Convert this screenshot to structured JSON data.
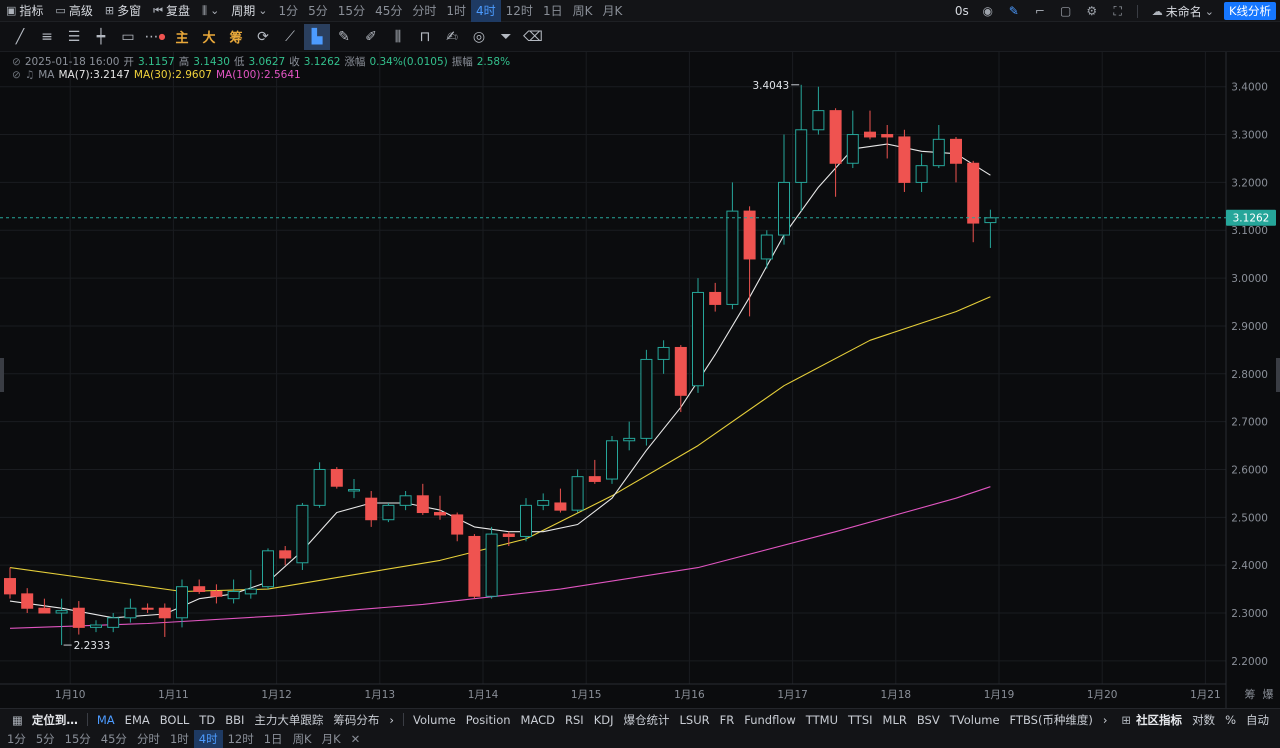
{
  "topbar": {
    "tools": [
      {
        "icon": "indicator-icon",
        "label": "指标"
      },
      {
        "icon": "advanced-icon",
        "label": "高级"
      },
      {
        "icon": "multi-window-icon",
        "label": "多窗"
      },
      {
        "icon": "replay-icon",
        "label": "复盘"
      }
    ],
    "chart_type_icon": "candle-type-icon",
    "period_label": "周期",
    "periods": [
      "1分",
      "5分",
      "15分",
      "45分",
      "分时",
      "1时",
      "4时",
      "12时",
      "1日",
      "周K",
      "月K"
    ],
    "active_period": "4时",
    "countdown": "0s",
    "template_name": "未命名",
    "analysis_button": "K线分析"
  },
  "drawbar": {
    "tools": [
      {
        "name": "trend-line-icon",
        "glyph": "╱"
      },
      {
        "name": "parallel-line-icon",
        "glyph": "≡"
      },
      {
        "name": "channel-icon",
        "glyph": "☰"
      },
      {
        "name": "horizontal-ray-icon",
        "glyph": "┿"
      },
      {
        "name": "rectangle-icon",
        "glyph": "▭"
      },
      {
        "name": "more-tools-icon",
        "glyph": "⋯"
      },
      {
        "name": "main-label",
        "glyph": "主"
      },
      {
        "name": "big-label",
        "glyph": "大"
      },
      {
        "name": "chip-label",
        "glyph": "筹"
      },
      {
        "name": "sync-icon",
        "glyph": "⟳"
      },
      {
        "name": "measure-icon",
        "glyph": "⟋"
      },
      {
        "name": "magnet-icon",
        "glyph": "▙"
      },
      {
        "name": "pen-icon",
        "glyph": "✎"
      },
      {
        "name": "eraser-icon",
        "glyph": "✐"
      },
      {
        "name": "candle-compare-icon",
        "glyph": "⫼"
      },
      {
        "name": "lock-icon",
        "glyph": "🔒"
      },
      {
        "name": "note-icon",
        "glyph": "✍"
      },
      {
        "name": "visibility-icon",
        "glyph": "◎"
      },
      {
        "name": "filter-icon",
        "glyph": "⏷"
      },
      {
        "name": "trash-icon",
        "glyph": "🗑"
      }
    ]
  },
  "legend": {
    "date": "2025-01-18 16:00",
    "open_label": "开",
    "open": "3.1157",
    "high_label": "高",
    "high": "3.1430",
    "low_label": "低",
    "low": "3.0627",
    "close_label": "收",
    "close": "3.1262",
    "change_label": "涨幅",
    "change": "0.34%(0.0105)",
    "amp_label": "振幅",
    "amp": "2.58%",
    "ma_label": "MA",
    "ma7": "MA(7):3.2147",
    "ma30": "MA(30):2.9607",
    "ma100": "MA(100):2.5641"
  },
  "chart_data": {
    "type": "candlestick",
    "interval": "4h",
    "y_range": [
      2.16,
      3.46
    ],
    "y_ticks": [
      "3.4000",
      "3.3000",
      "3.2000",
      "3.1000",
      "3.0000",
      "2.9000",
      "2.8000",
      "2.7000",
      "2.6000",
      "2.5000",
      "2.4000",
      "2.3000",
      "2.2000"
    ],
    "x_ticks": [
      "1月10",
      "1月11",
      "1月12",
      "1月13",
      "1月14",
      "1月15",
      "1月16",
      "1月17",
      "1月18",
      "1月19",
      "1月20",
      "1月21"
    ],
    "x_tick_index": [
      3.5,
      9.5,
      15.5,
      21.5,
      27.5,
      33.5,
      39.5,
      45.5,
      51.5,
      57.5,
      63.5,
      69.5
    ],
    "current_price": "3.1262",
    "max_label": "3.4043",
    "min_label": "2.2333",
    "colors": {
      "up": "#26a69a",
      "down": "#ef5350",
      "ma7": "#e8e8e8",
      "ma30": "#e6cf3a",
      "ma100": "#e055c0",
      "price_line": "#26a69a"
    },
    "candles": [
      {
        "o": 2.372,
        "h": 2.395,
        "l": 2.33,
        "c": 2.34
      },
      {
        "o": 2.34,
        "h": 2.352,
        "l": 2.3,
        "c": 2.31
      },
      {
        "o": 2.31,
        "h": 2.33,
        "l": 2.3,
        "c": 2.3
      },
      {
        "o": 2.3,
        "h": 2.33,
        "l": 2.233,
        "c": 2.305
      },
      {
        "o": 2.31,
        "h": 2.325,
        "l": 2.255,
        "c": 2.27
      },
      {
        "o": 2.27,
        "h": 2.285,
        "l": 2.26,
        "c": 2.275
      },
      {
        "o": 2.27,
        "h": 2.3,
        "l": 2.26,
        "c": 2.29
      },
      {
        "o": 2.29,
        "h": 2.33,
        "l": 2.28,
        "c": 2.31
      },
      {
        "o": 2.31,
        "h": 2.32,
        "l": 2.3,
        "c": 2.308
      },
      {
        "o": 2.31,
        "h": 2.32,
        "l": 2.25,
        "c": 2.29
      },
      {
        "o": 2.29,
        "h": 2.37,
        "l": 2.27,
        "c": 2.355
      },
      {
        "o": 2.355,
        "h": 2.37,
        "l": 2.34,
        "c": 2.345
      },
      {
        "o": 2.345,
        "h": 2.36,
        "l": 2.32,
        "c": 2.335
      },
      {
        "o": 2.33,
        "h": 2.37,
        "l": 2.32,
        "c": 2.345
      },
      {
        "o": 2.34,
        "h": 2.39,
        "l": 2.33,
        "c": 2.35
      },
      {
        "o": 2.355,
        "h": 2.435,
        "l": 2.35,
        "c": 2.43
      },
      {
        "o": 2.43,
        "h": 2.44,
        "l": 2.4,
        "c": 2.415
      },
      {
        "o": 2.405,
        "h": 2.53,
        "l": 2.39,
        "c": 2.525
      },
      {
        "o": 2.525,
        "h": 2.615,
        "l": 2.52,
        "c": 2.6
      },
      {
        "o": 2.6,
        "h": 2.605,
        "l": 2.56,
        "c": 2.565
      },
      {
        "o": 2.555,
        "h": 2.58,
        "l": 2.54,
        "c": 2.558
      },
      {
        "o": 2.54,
        "h": 2.555,
        "l": 2.48,
        "c": 2.495
      },
      {
        "o": 2.495,
        "h": 2.53,
        "l": 2.49,
        "c": 2.525
      },
      {
        "o": 2.525,
        "h": 2.555,
        "l": 2.515,
        "c": 2.545
      },
      {
        "o": 2.545,
        "h": 2.57,
        "l": 2.505,
        "c": 2.51
      },
      {
        "o": 2.51,
        "h": 2.545,
        "l": 2.495,
        "c": 2.505
      },
      {
        "o": 2.505,
        "h": 2.51,
        "l": 2.45,
        "c": 2.465
      },
      {
        "o": 2.46,
        "h": 2.465,
        "l": 2.33,
        "c": 2.335
      },
      {
        "o": 2.335,
        "h": 2.48,
        "l": 2.33,
        "c": 2.465
      },
      {
        "o": 2.465,
        "h": 2.47,
        "l": 2.44,
        "c": 2.46
      },
      {
        "o": 2.46,
        "h": 2.54,
        "l": 2.45,
        "c": 2.525
      },
      {
        "o": 2.525,
        "h": 2.55,
        "l": 2.515,
        "c": 2.535
      },
      {
        "o": 2.53,
        "h": 2.56,
        "l": 2.51,
        "c": 2.515
      },
      {
        "o": 2.515,
        "h": 2.6,
        "l": 2.51,
        "c": 2.585
      },
      {
        "o": 2.585,
        "h": 2.62,
        "l": 2.57,
        "c": 2.575
      },
      {
        "o": 2.58,
        "h": 2.67,
        "l": 2.57,
        "c": 2.66
      },
      {
        "o": 2.66,
        "h": 2.7,
        "l": 2.64,
        "c": 2.665
      },
      {
        "o": 2.665,
        "h": 2.85,
        "l": 2.65,
        "c": 2.83
      },
      {
        "o": 2.83,
        "h": 2.87,
        "l": 2.8,
        "c": 2.855
      },
      {
        "o": 2.855,
        "h": 2.86,
        "l": 2.72,
        "c": 2.755
      },
      {
        "o": 2.775,
        "h": 3.0,
        "l": 2.76,
        "c": 2.97
      },
      {
        "o": 2.97,
        "h": 2.99,
        "l": 2.93,
        "c": 2.945
      },
      {
        "o": 2.945,
        "h": 3.2,
        "l": 2.935,
        "c": 3.14
      },
      {
        "o": 3.14,
        "h": 3.15,
        "l": 2.92,
        "c": 3.04
      },
      {
        "o": 3.04,
        "h": 3.1,
        "l": 3.02,
        "c": 3.09
      },
      {
        "o": 3.09,
        "h": 3.3,
        "l": 3.07,
        "c": 3.2
      },
      {
        "o": 3.2,
        "h": 3.404,
        "l": 3.14,
        "c": 3.31
      },
      {
        "o": 3.31,
        "h": 3.4,
        "l": 3.3,
        "c": 3.35
      },
      {
        "o": 3.35,
        "h": 3.355,
        "l": 3.17,
        "c": 3.24
      },
      {
        "o": 3.24,
        "h": 3.35,
        "l": 3.23,
        "c": 3.3
      },
      {
        "o": 3.305,
        "h": 3.35,
        "l": 3.29,
        "c": 3.295
      },
      {
        "o": 3.3,
        "h": 3.32,
        "l": 3.25,
        "c": 3.295
      },
      {
        "o": 3.295,
        "h": 3.31,
        "l": 3.18,
        "c": 3.2
      },
      {
        "o": 3.2,
        "h": 3.26,
        "l": 3.18,
        "c": 3.235
      },
      {
        "o": 3.235,
        "h": 3.32,
        "l": 3.23,
        "c": 3.29
      },
      {
        "o": 3.29,
        "h": 3.295,
        "l": 3.2,
        "c": 3.24
      },
      {
        "o": 3.24,
        "h": 3.245,
        "l": 3.075,
        "c": 3.115
      },
      {
        "o": 3.116,
        "h": 3.143,
        "l": 3.063,
        "c": 3.126
      }
    ],
    "ma7": [
      [
        0,
        2.325
      ],
      [
        3,
        2.31
      ],
      [
        6,
        2.29
      ],
      [
        9,
        2.298
      ],
      [
        11,
        2.33
      ],
      [
        13,
        2.34
      ],
      [
        15,
        2.365
      ],
      [
        17,
        2.43
      ],
      [
        19,
        2.51
      ],
      [
        21,
        2.53
      ],
      [
        23,
        2.53
      ],
      [
        25,
        2.515
      ],
      [
        27,
        2.48
      ],
      [
        29,
        2.47
      ],
      [
        31,
        2.47
      ],
      [
        33,
        2.485
      ],
      [
        35,
        2.54
      ],
      [
        37,
        2.64
      ],
      [
        39,
        2.73
      ],
      [
        41,
        2.84
      ],
      [
        43,
        2.96
      ],
      [
        45,
        3.09
      ],
      [
        47,
        3.19
      ],
      [
        49,
        3.27
      ],
      [
        51,
        3.28
      ],
      [
        53,
        3.265
      ],
      [
        55,
        3.26
      ],
      [
        57,
        3.215
      ]
    ],
    "ma30": [
      [
        0,
        2.395
      ],
      [
        5,
        2.37
      ],
      [
        10,
        2.345
      ],
      [
        15,
        2.35
      ],
      [
        20,
        2.38
      ],
      [
        25,
        2.41
      ],
      [
        30,
        2.455
      ],
      [
        35,
        2.545
      ],
      [
        40,
        2.65
      ],
      [
        45,
        2.775
      ],
      [
        50,
        2.87
      ],
      [
        55,
        2.93
      ],
      [
        57,
        2.961
      ]
    ],
    "ma100": [
      [
        0,
        2.268
      ],
      [
        8,
        2.278
      ],
      [
        16,
        2.295
      ],
      [
        24,
        2.318
      ],
      [
        32,
        2.35
      ],
      [
        40,
        2.395
      ],
      [
        48,
        2.47
      ],
      [
        55,
        2.54
      ],
      [
        57,
        2.564
      ]
    ]
  },
  "indicators": {
    "locate": "定位到…",
    "main": [
      "MA",
      "EMA",
      "BOLL",
      "TD",
      "BBI",
      "主力大单跟踪",
      "筹码分布"
    ],
    "active": "MA",
    "sub": [
      "Volume",
      "Position",
      "MACD",
      "RSI",
      "KDJ",
      "爆仓统计",
      "LSUR",
      "FR",
      "Fundflow",
      "TTMU",
      "TTSI",
      "MLR",
      "BSV",
      "TVolume",
      "FTBS(币种维度)"
    ],
    "right": [
      "社区指标",
      "对数",
      "%",
      "自动"
    ],
    "corner": [
      "筹",
      "爆"
    ]
  },
  "bottom_periods": [
    "1分",
    "5分",
    "15分",
    "45分",
    "分时",
    "1时",
    "4时",
    "12时",
    "1日",
    "周K",
    "月K"
  ],
  "bottom_active": "4时"
}
